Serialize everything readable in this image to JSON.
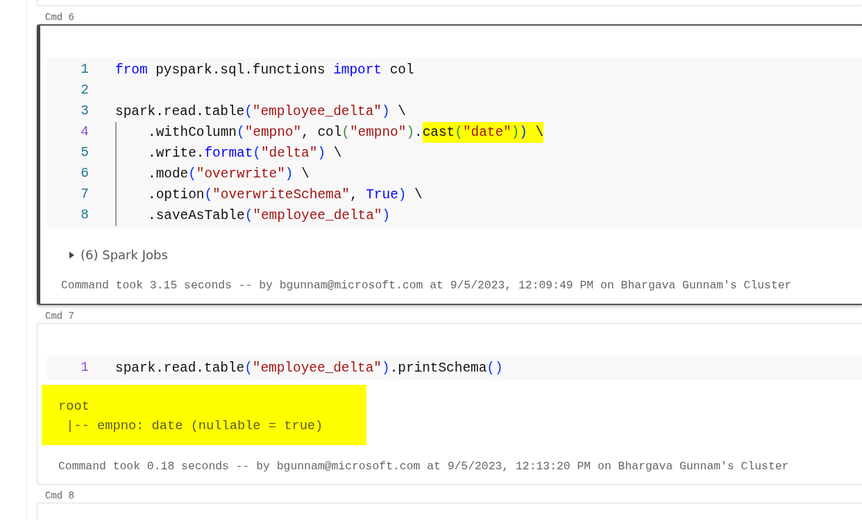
{
  "cells": [
    {
      "label": "Cmd 6",
      "selected": true,
      "lines": [
        {
          "number": "1",
          "active": false,
          "indented": false,
          "tokens": [
            {
              "kind": "keyword",
              "text": "from"
            },
            {
              "kind": "plain",
              "text": " pyspark.sql.functions "
            },
            {
              "kind": "keyword",
              "text": "import"
            },
            {
              "kind": "plain",
              "text": " col"
            }
          ]
        },
        {
          "number": "2",
          "active": false,
          "indented": false
        },
        {
          "number": "3",
          "active": false,
          "indented": false,
          "tokens": [
            {
              "kind": "plain",
              "text": "spark.read.table"
            },
            {
              "kind": "paren1",
              "text": "("
            },
            {
              "kind": "string",
              "text": "\"employee_delta\""
            },
            {
              "kind": "paren1",
              "text": ")"
            },
            {
              "kind": "plain",
              "text": " \\"
            }
          ]
        },
        {
          "number": "4",
          "active": true,
          "indented": true,
          "tokens": [
            {
              "kind": "plain",
              "text": ".withColumn"
            },
            {
              "kind": "paren1",
              "text": "("
            },
            {
              "kind": "string",
              "text": "\"empno\""
            },
            {
              "kind": "plain",
              "text": ", col"
            },
            {
              "kind": "paren2",
              "text": "("
            },
            {
              "kind": "string",
              "text": "\"empno\""
            },
            {
              "kind": "paren2",
              "text": ")"
            },
            {
              "kind": "plain",
              "text": "."
            },
            {
              "kind": "plain",
              "text": "cast",
              "highlighted": true
            },
            {
              "kind": "paren2",
              "text": "(",
              "highlighted": true
            },
            {
              "kind": "string",
              "text": "\"date\"",
              "highlighted": true
            },
            {
              "kind": "paren2",
              "text": ")",
              "highlighted": true
            },
            {
              "kind": "paren1",
              "text": ")",
              "highlighted": true
            },
            {
              "kind": "plain",
              "text": " \\",
              "highlighted": true
            }
          ]
        },
        {
          "number": "5",
          "active": false,
          "indented": true,
          "tokens": [
            {
              "kind": "plain",
              "text": ".write."
            },
            {
              "kind": "keyword",
              "text": "format"
            },
            {
              "kind": "paren1",
              "text": "("
            },
            {
              "kind": "string",
              "text": "\"delta\""
            },
            {
              "kind": "paren1",
              "text": ")"
            },
            {
              "kind": "plain",
              "text": " \\"
            }
          ]
        },
        {
          "number": "6",
          "active": false,
          "indented": true,
          "tokens": [
            {
              "kind": "plain",
              "text": ".mode"
            },
            {
              "kind": "paren1",
              "text": "("
            },
            {
              "kind": "string",
              "text": "\"overwrite\""
            },
            {
              "kind": "paren1",
              "text": ")"
            },
            {
              "kind": "plain",
              "text": " \\"
            }
          ]
        },
        {
          "number": "7",
          "active": false,
          "indented": true,
          "tokens": [
            {
              "kind": "plain",
              "text": ".option"
            },
            {
              "kind": "paren1",
              "text": "("
            },
            {
              "kind": "string",
              "text": "\"overwriteSchema\""
            },
            {
              "kind": "plain",
              "text": ", "
            },
            {
              "kind": "keyword",
              "text": "True"
            },
            {
              "kind": "paren1",
              "text": ")"
            },
            {
              "kind": "plain",
              "text": " \\"
            }
          ]
        },
        {
          "number": "8",
          "active": false,
          "indented": true,
          "tokens": [
            {
              "kind": "plain",
              "text": ".saveAsTable"
            },
            {
              "kind": "paren1",
              "text": "("
            },
            {
              "kind": "string",
              "text": "\"employee_delta\""
            },
            {
              "kind": "paren1",
              "text": ")"
            }
          ]
        }
      ],
      "spark_jobs": {
        "text": "(6) Spark Jobs",
        "expanded": false
      },
      "footer": "Command took 3.15 seconds -- by bgunnam@microsoft.com at 9/5/2023, 12:09:49 PM on Bhargava Gunnam's Cluster"
    },
    {
      "label": "Cmd 7",
      "selected": false,
      "lines": [
        {
          "number": "1",
          "active": true,
          "indented": false,
          "tokens": [
            {
              "kind": "plain",
              "text": "spark.read.table"
            },
            {
              "kind": "paren1",
              "text": "("
            },
            {
              "kind": "string",
              "text": "\"employee_delta\""
            },
            {
              "kind": "paren1",
              "text": ")"
            },
            {
              "kind": "plain",
              "text": ".printSchema"
            },
            {
              "kind": "paren1",
              "text": "()"
            }
          ]
        }
      ],
      "output": {
        "highlighted": true,
        "lines": [
          "root",
          " |-- empno: date (nullable = true)"
        ]
      },
      "footer": "Command took 0.18 seconds -- by bgunnam@microsoft.com at 9/5/2023, 12:13:20 PM on Bhargava Gunnam's Cluster"
    },
    {
      "label": "Cmd 8",
      "selected": false
    }
  ]
}
